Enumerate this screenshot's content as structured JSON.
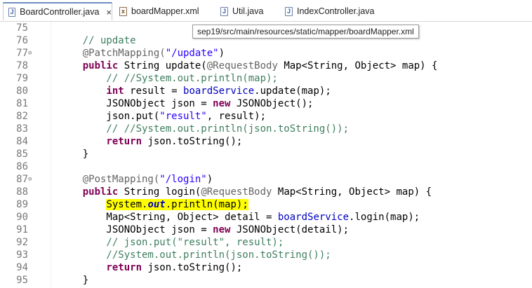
{
  "tabs": [
    {
      "label": "BoardController.java",
      "icon": "java-file-icon",
      "active": true,
      "closable": true
    },
    {
      "label": "boardMapper.xml",
      "icon": "xml-file-icon",
      "active": false
    },
    {
      "label": "Util.java",
      "icon": "java-file-icon",
      "active": false
    },
    {
      "label": "IndexController.java",
      "icon": "java-file-icon",
      "active": false
    }
  ],
  "tab_icon_letters": {
    "java": "J",
    "xml": "x"
  },
  "tab_close_glyph": "×",
  "tooltip": "sep19/src/main/resources/static/mapper/boardMapper.xml",
  "colors": {
    "keyword": "#7f0055",
    "comment": "#3f7f5f",
    "string": "#2a00ff",
    "annotation": "#646464",
    "field": "#0000c0",
    "highlight": "#ffff00"
  },
  "lines": [
    {
      "n": "75",
      "fold": "",
      "tokens": []
    },
    {
      "n": "76",
      "fold": "",
      "tokens": [
        [
          "cm",
          "    // update"
        ]
      ]
    },
    {
      "n": "77",
      "fold": "⊖",
      "tokens": [
        [
          "an",
          "    @PatchMapping("
        ],
        [
          "st",
          "\"/update\""
        ],
        [
          "",
          ")"
        ]
      ]
    },
    {
      "n": "78",
      "fold": "",
      "tokens": [
        [
          "kw",
          "    public"
        ],
        [
          "",
          " String update("
        ],
        [
          "an",
          "@RequestBody"
        ],
        [
          "",
          " Map<String, Object> map) {"
        ]
      ]
    },
    {
      "n": "79",
      "fold": "",
      "tokens": [
        [
          "cm",
          "        // //System.out.println(map);"
        ]
      ]
    },
    {
      "n": "80",
      "fold": "",
      "tokens": [
        [
          "kw",
          "        int"
        ],
        [
          "",
          " result = "
        ],
        [
          "fld",
          "boardService"
        ],
        [
          "",
          ".update(map);"
        ]
      ]
    },
    {
      "n": "81",
      "fold": "",
      "tokens": [
        [
          "",
          "        JSONObject json = "
        ],
        [
          "kw",
          "new"
        ],
        [
          "",
          " JSONObject();"
        ]
      ]
    },
    {
      "n": "82",
      "fold": "",
      "tokens": [
        [
          "",
          "        json.put("
        ],
        [
          "st",
          "\"result\""
        ],
        [
          "",
          ", result);"
        ]
      ]
    },
    {
      "n": "83",
      "fold": "",
      "tokens": [
        [
          "cm",
          "        // //System.out.println(json.toString());"
        ]
      ]
    },
    {
      "n": "84",
      "fold": "",
      "tokens": [
        [
          "kw",
          "        return"
        ],
        [
          "",
          " json.toString();"
        ]
      ]
    },
    {
      "n": "85",
      "fold": "",
      "tokens": [
        [
          "",
          "    }"
        ]
      ]
    },
    {
      "n": "86",
      "fold": "",
      "tokens": []
    },
    {
      "n": "87",
      "fold": "⊖",
      "tokens": [
        [
          "an",
          "    @PostMapping("
        ],
        [
          "st",
          "\"/login\""
        ],
        [
          "",
          ")"
        ]
      ]
    },
    {
      "n": "88",
      "fold": "",
      "tokens": [
        [
          "kw",
          "    public"
        ],
        [
          "",
          " String login("
        ],
        [
          "an",
          "@RequestBody"
        ],
        [
          "",
          " Map<String, Object> map) {"
        ]
      ]
    },
    {
      "n": "89",
      "fold": "",
      "tokens": [
        [
          "",
          "        "
        ],
        [
          "hl",
          "System."
        ],
        [
          "hl it",
          "out"
        ],
        [
          "hl",
          ".println(map);"
        ]
      ]
    },
    {
      "n": "90",
      "fold": "",
      "tokens": [
        [
          "",
          "        Map<String, Object> detail = "
        ],
        [
          "fld",
          "boardService"
        ],
        [
          "",
          ".login(map);"
        ]
      ]
    },
    {
      "n": "91",
      "fold": "",
      "tokens": [
        [
          "",
          "        JSONObject json = "
        ],
        [
          "kw",
          "new"
        ],
        [
          "",
          " JSONObject(detail);"
        ]
      ]
    },
    {
      "n": "92",
      "fold": "",
      "tokens": [
        [
          "cm",
          "        // json.put(\"result\", result);"
        ]
      ]
    },
    {
      "n": "93",
      "fold": "",
      "tokens": [
        [
          "cm",
          "        //System.out.println(json.toString());"
        ]
      ]
    },
    {
      "n": "94",
      "fold": "",
      "tokens": [
        [
          "kw",
          "        return"
        ],
        [
          "",
          " json.toString();"
        ]
      ]
    },
    {
      "n": "95",
      "fold": "",
      "tokens": [
        [
          "",
          "    }"
        ]
      ]
    }
  ]
}
